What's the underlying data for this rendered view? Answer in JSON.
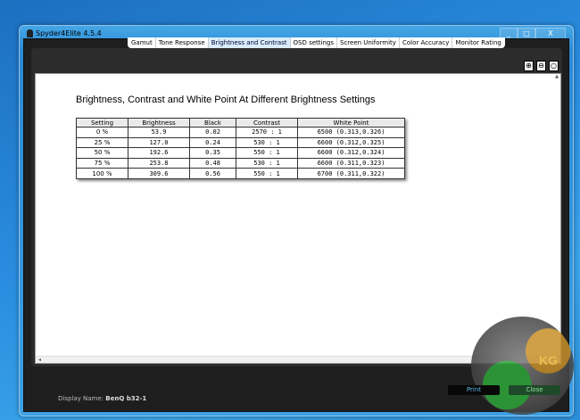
{
  "window": {
    "title": "Spyder4Elite 4.5.4",
    "controls": [
      "_",
      "□",
      "X"
    ]
  },
  "tabs": [
    {
      "label": "Gamut"
    },
    {
      "label": "Tone Response"
    },
    {
      "label": "Brightness and Contrast",
      "active": true
    },
    {
      "label": "OSD settings"
    },
    {
      "label": "Screen Uniformity"
    },
    {
      "label": "Color Accuracy"
    },
    {
      "label": "Monitor Rating"
    }
  ],
  "zoom_buttons": [
    "zoom-in",
    "zoom-out",
    "zoom-reset"
  ],
  "report": {
    "heading": "Brightness, Contrast and White Point At Different Brightness Settings",
    "columns": [
      "Setting",
      "Brightness",
      "Black",
      "Contrast",
      "White Point"
    ],
    "rows": [
      [
        "0 %",
        "53.9",
        "0.02",
        "2570 : 1",
        "6500 (0.313,0.326)"
      ],
      [
        "25 %",
        "127.0",
        "0.24",
        "530 : 1",
        "6600 (0.312,0.325)"
      ],
      [
        "50 %",
        "192.6",
        "0.35",
        "550 : 1",
        "6600 (0.312,0.324)"
      ],
      [
        "75 %",
        "253.8",
        "0.48",
        "530 : 1",
        "6600 (0.311,0.323)"
      ],
      [
        "100 %",
        "309.6",
        "0.56",
        "550 : 1",
        "6700 (0.311,0.322)"
      ]
    ]
  },
  "footer": {
    "display_label": "Display Name:",
    "display_value": "BenQ b32-1",
    "print": "Print",
    "close": "Close"
  },
  "watermark": "KG"
}
